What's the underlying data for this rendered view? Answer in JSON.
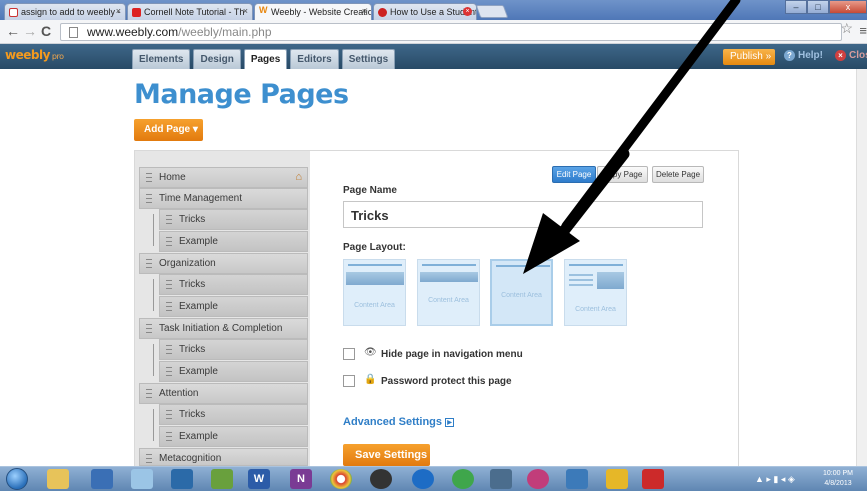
{
  "browser": {
    "tabs": [
      {
        "title": "assign to add to weebly -",
        "icon": "gmail-icon"
      },
      {
        "title": "Cornell Note Tutorial - Th",
        "icon": "youtube-icon"
      },
      {
        "title": "Weebly - Website Creatio",
        "icon": "weebly-icon"
      },
      {
        "title": "How to Use a Student Pla",
        "icon": "chrome-page-icon"
      }
    ],
    "url_host": "www.weebly.com",
    "url_path": "/weebly/main.php"
  },
  "weebly": {
    "logo": "weebly",
    "logo_badge": "pro",
    "tabs": [
      "Elements",
      "Design",
      "Pages",
      "Editors",
      "Settings"
    ],
    "active_tab": "Pages",
    "publish_label": "Publish »",
    "help_label": "Help!",
    "close_label": "Close"
  },
  "page": {
    "title": "Manage Pages",
    "add_page_label": "Add Page ▾",
    "sidebar": [
      {
        "label": "Home",
        "level": 0
      },
      {
        "label": "Time Management",
        "level": 0
      },
      {
        "label": "Tricks",
        "level": 1
      },
      {
        "label": "Example",
        "level": 1
      },
      {
        "label": "Organization",
        "level": 0
      },
      {
        "label": "Tricks",
        "level": 1
      },
      {
        "label": "Example",
        "level": 1
      },
      {
        "label": "Task Initiation & Completion",
        "level": 0
      },
      {
        "label": "Tricks",
        "level": 1
      },
      {
        "label": "Example",
        "level": 1
      },
      {
        "label": "Attention",
        "level": 0
      },
      {
        "label": "Tricks",
        "level": 1
      },
      {
        "label": "Example",
        "level": 1
      },
      {
        "label": "Metacognition",
        "level": 0
      }
    ],
    "edit_page_label": "Edit Page",
    "copy_page_label": "Copy Page",
    "delete_page_label": "Delete Page",
    "page_name_label": "Page Name",
    "page_name_value": "Tricks",
    "page_layout_label": "Page Layout:",
    "layouts": [
      {
        "label": "Content Area"
      },
      {
        "label": "Content Area"
      },
      {
        "label": "Content Area"
      },
      {
        "label": "Content Area"
      }
    ],
    "selected_layout_index": 2,
    "hide_page_label": "Hide page in navigation menu",
    "password_label": "Password protect this page",
    "advanced_label": "Advanced Settings",
    "save_label": "Save Settings"
  },
  "taskbar": {
    "time": "10:00 PM",
    "date": "4/8/2013"
  },
  "colors": {
    "accent_orange": "#e8870f",
    "title_blue": "#3d8fcf",
    "link_blue": "#2f7ec7"
  }
}
